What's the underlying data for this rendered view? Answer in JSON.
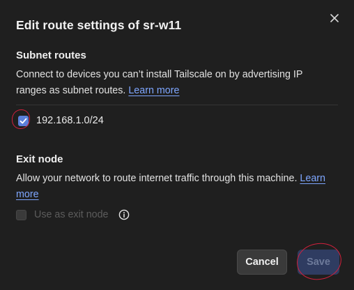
{
  "dialog": {
    "title": "Edit route settings of sr-w11",
    "close_icon": "close-icon"
  },
  "subnet_routes": {
    "heading": "Subnet routes",
    "description": "Connect to devices you can’t install Tailscale on by advertising IP ranges as subnet routes.",
    "learn_more": "Learn more",
    "routes": [
      {
        "label": "192.168.1.0/24",
        "checked": true
      }
    ]
  },
  "exit_node": {
    "heading": "Exit node",
    "description": "Allow your network to route internet traffic through this machine.",
    "learn_more": "Learn more",
    "checkbox_label": "Use as exit node",
    "checked": false,
    "disabled": true,
    "info_icon": "info-icon"
  },
  "actions": {
    "cancel_label": "Cancel",
    "save_label": "Save"
  },
  "colors": {
    "background": "#1f1f1f",
    "accent": "#5b7fd9",
    "link": "#7ea6ff",
    "save_disabled_bg": "#2f3c61",
    "annotation_red": "#d2203d"
  }
}
